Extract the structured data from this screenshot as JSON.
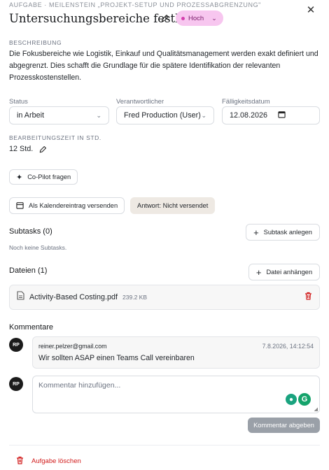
{
  "header": {
    "eyebrow": "AUFGABE · MEILENSTEIN „PROJEKT-SETUP UND PROZESSABGRENZUNG\"",
    "title": "Untersuchungsbereiche festlegen",
    "priority": "Hoch",
    "close_icon": "close-icon"
  },
  "description": {
    "label": "BESCHREIBUNG",
    "text": "Die Fokusbereiche wie Logistik, Einkauf und Qualitätsmanagement werden exakt definiert und abgegrenzt. Dies schafft die Grundlage für die spätere Identifikation der relevanten Prozesskostenstellen."
  },
  "fields": {
    "status_label": "Status",
    "status_value": "in Arbeit",
    "owner_label": "Verantwortlicher",
    "owner_value": "Fred Production (User)",
    "due_label": "Fälligkeitsdatum",
    "due_value": "12.08.2026"
  },
  "worktime": {
    "label": "BEARBEITUNGSZEIT IN STD.",
    "value": "12 Std."
  },
  "actions": {
    "copilot": "Co-Pilot fragen",
    "calendar": "Als Kalendereintrag versenden",
    "answer_status": "Antwort: Nicht versendet"
  },
  "subtasks": {
    "title": "Subtasks (0)",
    "add_label": "Subtask anlegen",
    "empty": "Noch keine Subtasks."
  },
  "files": {
    "title": "Dateien (1)",
    "attach_label": "Datei anhängen",
    "items": [
      {
        "name": "Activity-Based Costing.pdf",
        "size": "239.2 KB"
      }
    ]
  },
  "comments": {
    "title": "Kommentare",
    "items": [
      {
        "initials": "RP",
        "author": "reiner.pelzer@gmail.com",
        "timestamp": "7.8.2026, 14:12:54",
        "text": "Wir sollten ASAP einen Teams Call vereinbaren"
      }
    ],
    "input_initials": "RP",
    "placeholder": "Kommentar hinzufügen...",
    "submit_label": "Kommentar abgeben"
  },
  "footer": {
    "delete_label": "Aufgabe löschen"
  },
  "colors": {
    "priority_bg": "#f7c6ef",
    "priority_dot": "#d43fae",
    "danger": "#d11a1a",
    "submit_bg": "#9aa0a8"
  }
}
